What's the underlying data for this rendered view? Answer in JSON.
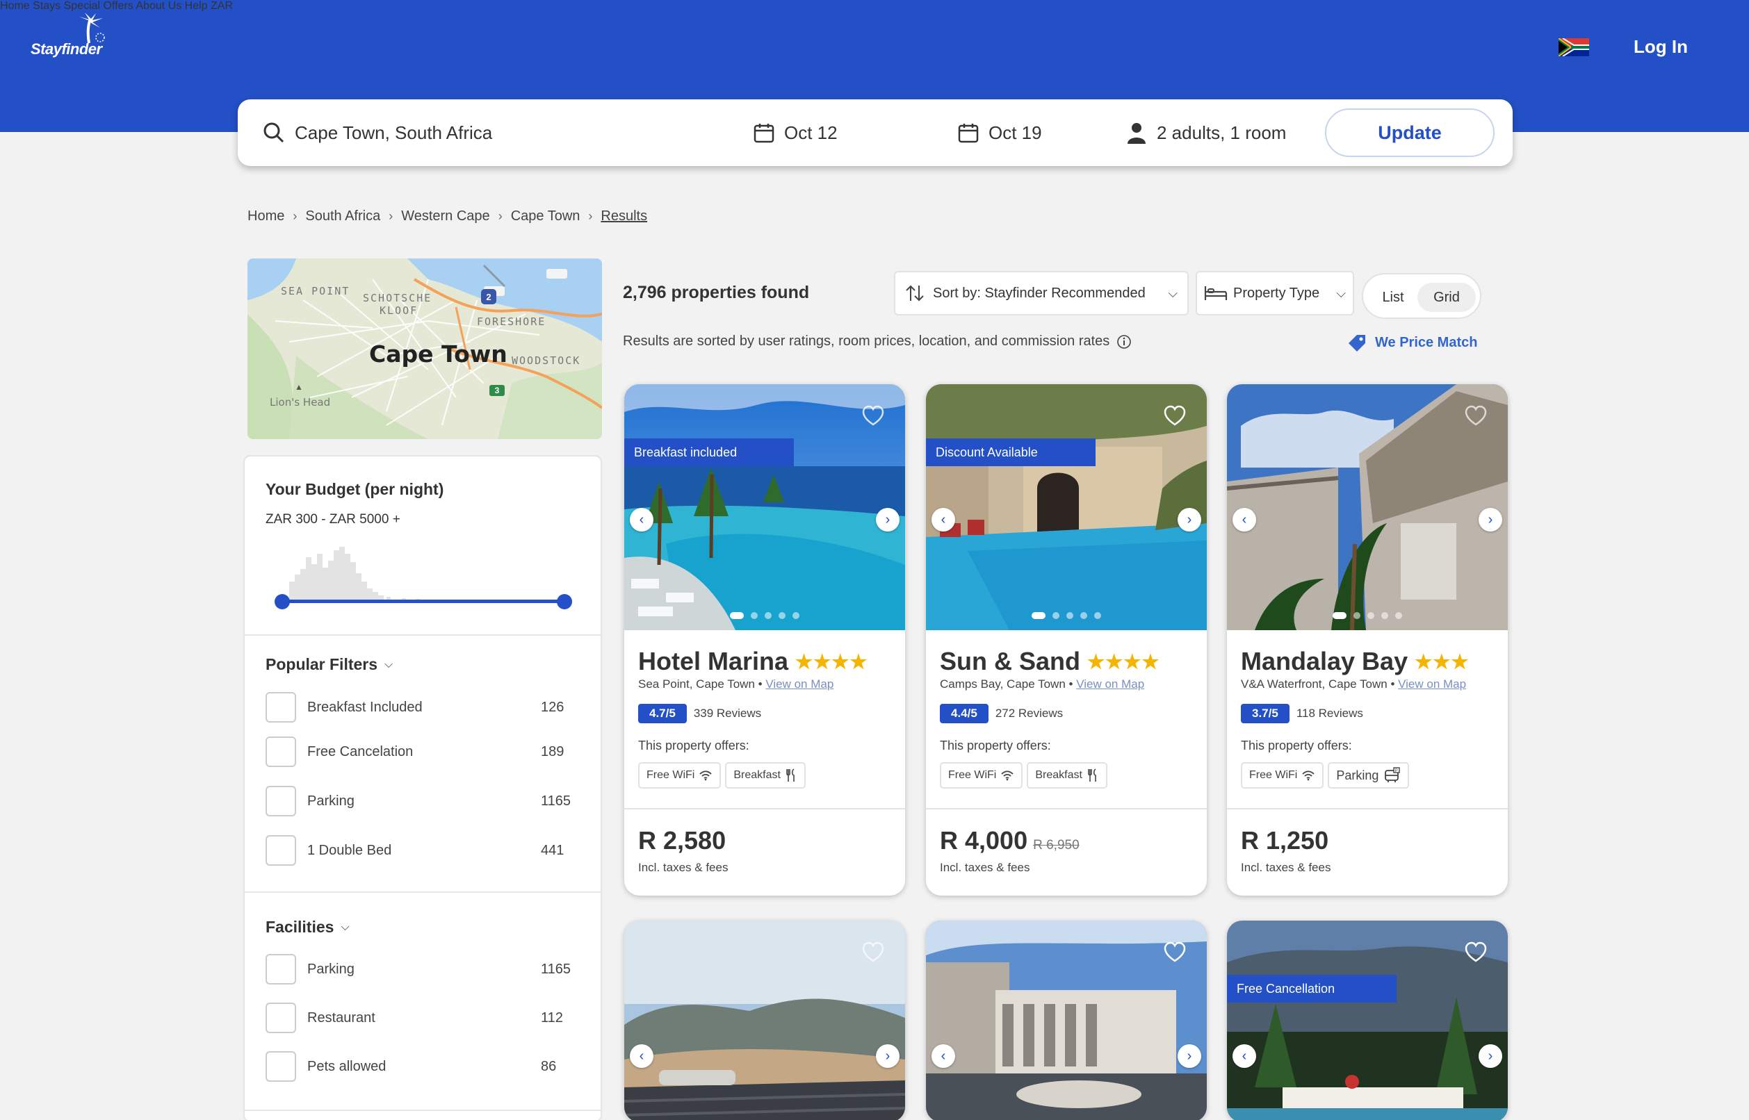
{
  "header": {
    "logo": "Stayfinder",
    "nav": [
      "Home",
      "Stays",
      "Special Offers",
      "About Us",
      "Help",
      "ZAR"
    ],
    "login": "Log In"
  },
  "search": {
    "destination": "Cape Town, South Africa",
    "checkin": "Oct 12",
    "checkout": "Oct 19",
    "guests": "2 adults, 1 room",
    "update": "Update"
  },
  "breadcrumb": [
    "Home",
    "South Africa",
    "Western Cape",
    "Cape Town",
    "Results"
  ],
  "map": {
    "city": "Cape Town",
    "labels": [
      "SEA POINT",
      "SCHOTSCHE",
      "KLOOF",
      "FORESHORE",
      "WOODSTOCK",
      "Lion's Head"
    ],
    "route_badges": [
      "2",
      "3"
    ]
  },
  "budget": {
    "title": "Your Budget (per night)",
    "range": "ZAR 300 - ZAR 5000 +",
    "min_fraction": 0.0,
    "max_fraction": 1.0
  },
  "popular_filters": {
    "title": "Popular Filters",
    "items": [
      {
        "label": "Breakfast Included",
        "count": "126"
      },
      {
        "label": "Free Cancelation",
        "count": "189"
      },
      {
        "label": "Parking",
        "count": "1165"
      },
      {
        "label": "1 Double Bed",
        "count": "441"
      }
    ]
  },
  "facilities": {
    "title": "Facilities",
    "items": [
      {
        "label": "Parking",
        "count": "1165"
      },
      {
        "label": "Restaurant",
        "count": "112"
      },
      {
        "label": "Pets allowed",
        "count": "86"
      }
    ]
  },
  "results": {
    "count": "2,796 properties found",
    "sort": "Sort by: Stayfinder Recommended",
    "property_type": "Property Type",
    "view_list": "List",
    "view_grid": "Grid",
    "note": "Results are sorted by user ratings, room prices, location, and commission rates",
    "price_match": "We Price Match"
  },
  "offers_label": "This property offers:",
  "incl_label": "Incl. taxes & fees",
  "view_map": "View on Map",
  "cards": [
    {
      "name": "Hotel Marina",
      "stars": "★★★★",
      "location": "Sea Point, Cape Town",
      "rating": "4.7/5",
      "reviews": "339 Reviews",
      "badge": "Breakfast included",
      "amenities": [
        "Free WiFi",
        "Breakfast"
      ],
      "price": "R 2,580",
      "old_price": ""
    },
    {
      "name": "Sun & Sand",
      "stars": "★★★★",
      "location": "Camps Bay, Cape Town",
      "rating": "4.4/5",
      "reviews": "272 Reviews",
      "badge": "Discount Available",
      "amenities": [
        "Free WiFi",
        "Breakfast"
      ],
      "price": "R 4,000",
      "old_price": "R 6,950"
    },
    {
      "name": "Mandalay Bay",
      "stars": "★★★",
      "location": "V&A Waterfront, Cape Town",
      "rating": "3.7/5",
      "reviews": "118 Reviews",
      "badge": "",
      "amenities": [
        "Free WiFi",
        "Parking"
      ],
      "price": "R 1,250",
      "old_price": ""
    }
  ],
  "cards_row2": [
    {
      "badge": ""
    },
    {
      "badge": ""
    },
    {
      "badge": "Free Cancellation"
    }
  ],
  "colors": {
    "brand": "#2350c6",
    "star": "#f5b400",
    "background": "#f2f2f2"
  }
}
